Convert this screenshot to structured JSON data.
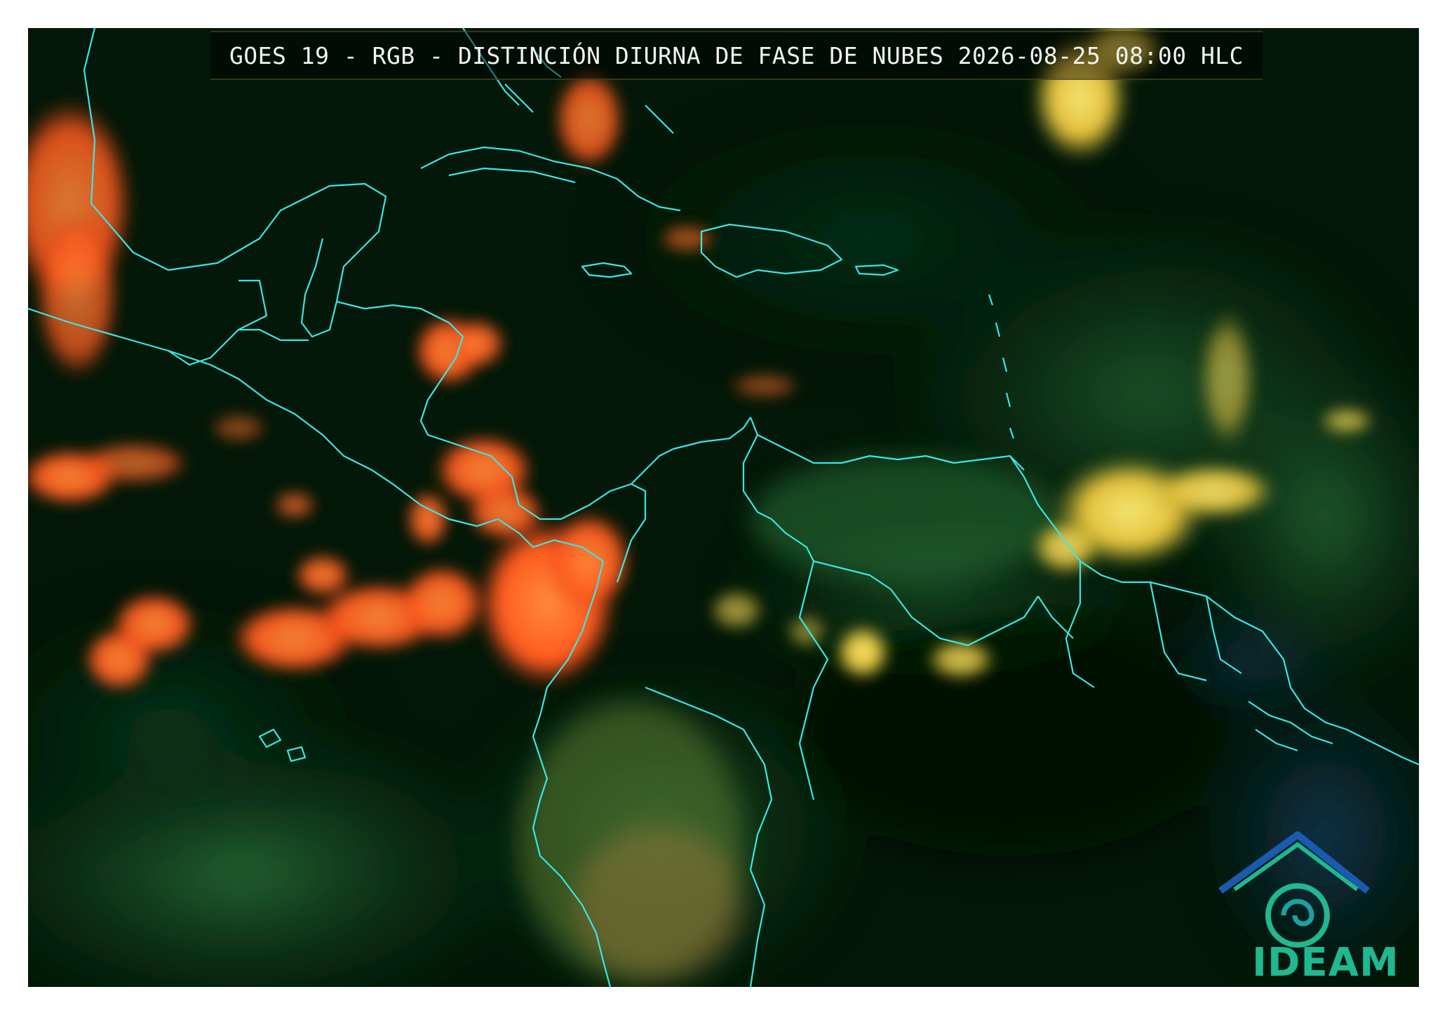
{
  "map": {
    "title": "GOES 19 - RGB - DISTINCIÓN DIURNA DE FASE DE NUBES 2026-08-25 08:00 HLC",
    "logo_text": "IDEAM",
    "colors": {
      "background": "#031a08",
      "coastline": "#39e6e6",
      "ice_cloud": "#ff5a1e",
      "water_cloud": "#f0d23c",
      "vegetation": "#1e6e3a",
      "logo": "#1fb890"
    }
  }
}
